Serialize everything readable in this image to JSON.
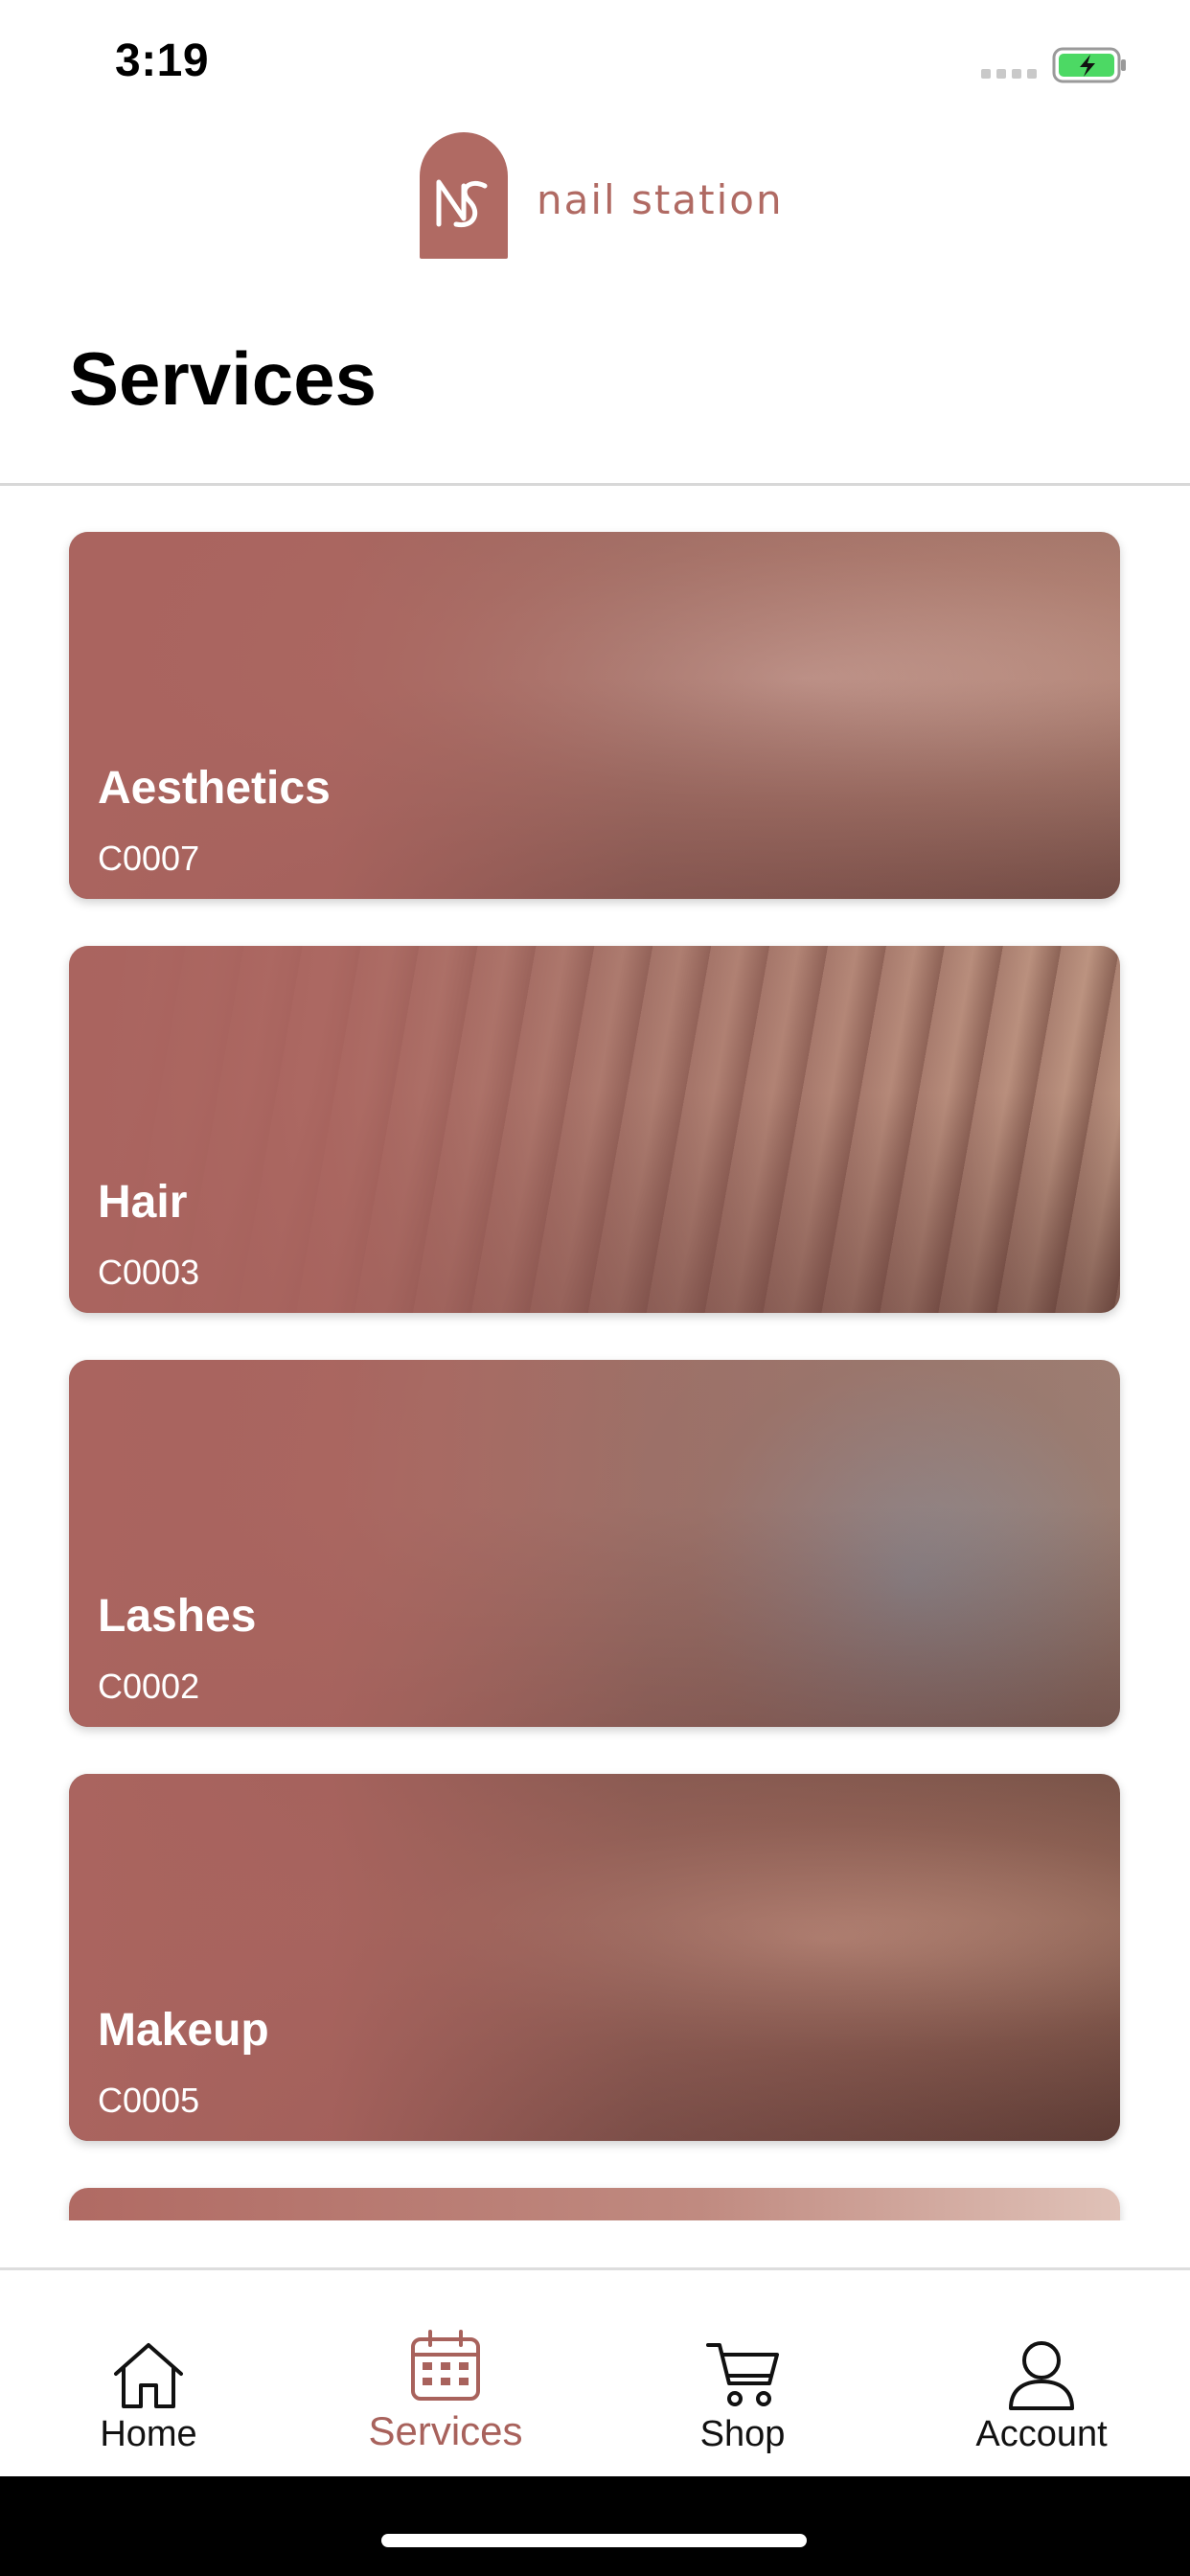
{
  "status_bar": {
    "time": "3:19"
  },
  "brand": {
    "name": "nail station",
    "color": "#b06a63"
  },
  "page": {
    "title": "Services"
  },
  "services": [
    {
      "title": "Aesthetics",
      "code": "C0007"
    },
    {
      "title": "Hair",
      "code": "C0003"
    },
    {
      "title": "Lashes",
      "code": "C0002"
    },
    {
      "title": "Makeup",
      "code": "C0005"
    },
    {
      "title": "",
      "code": ""
    }
  ],
  "tabbar": {
    "active_color": "#a8625c",
    "items": [
      {
        "label": "Home",
        "icon": "home-icon"
      },
      {
        "label": "Services",
        "icon": "calendar-icon"
      },
      {
        "label": "Shop",
        "icon": "cart-icon"
      },
      {
        "label": "Account",
        "icon": "person-icon"
      }
    ]
  }
}
